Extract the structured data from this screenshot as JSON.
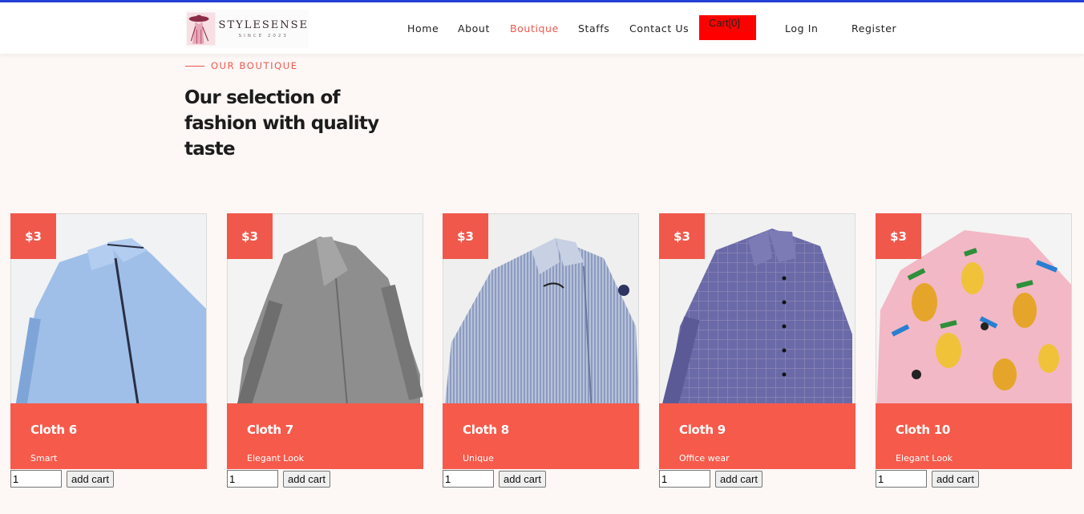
{
  "brand": {
    "name": "STYLESENSE",
    "tagline": "SINCE 2023"
  },
  "nav": {
    "home": "Home",
    "about": "About",
    "boutique": "Boutique",
    "staffs": "Staffs",
    "contact": "Contact Us",
    "cart": "Cart[0]",
    "login": "Log In",
    "register": "Register"
  },
  "colors": {
    "accent": "#f0584c",
    "card": "#f65a4b",
    "cart_button": "#ff0000",
    "top_border": "#2541d6"
  },
  "section": {
    "label": "OUR BOUTIQUE",
    "headline": "Our selection of fashion with quality taste"
  },
  "products": [
    {
      "price": "$3",
      "name": "Cloth 6",
      "desc": "Smart",
      "qty": "1",
      "button": "add cart",
      "image": "light-blue-shirt"
    },
    {
      "price": "$3",
      "name": "Cloth 7",
      "desc": "Elegant Look",
      "qty": "1",
      "button": "add cart",
      "image": "grey-ruffled-blouse"
    },
    {
      "price": "$3",
      "name": "Cloth 8",
      "desc": "Unique",
      "qty": "1",
      "button": "add cart",
      "image": "striped-blue-shirt"
    },
    {
      "price": "$3",
      "name": "Cloth 9",
      "desc": "Office wear",
      "qty": "1",
      "button": "add cart",
      "image": "checkered-purple-shirt"
    },
    {
      "price": "$3",
      "name": "Cloth 10",
      "desc": "Elegant Look",
      "qty": "1",
      "button": "add cart",
      "image": "pineapple-print-shirt"
    }
  ]
}
